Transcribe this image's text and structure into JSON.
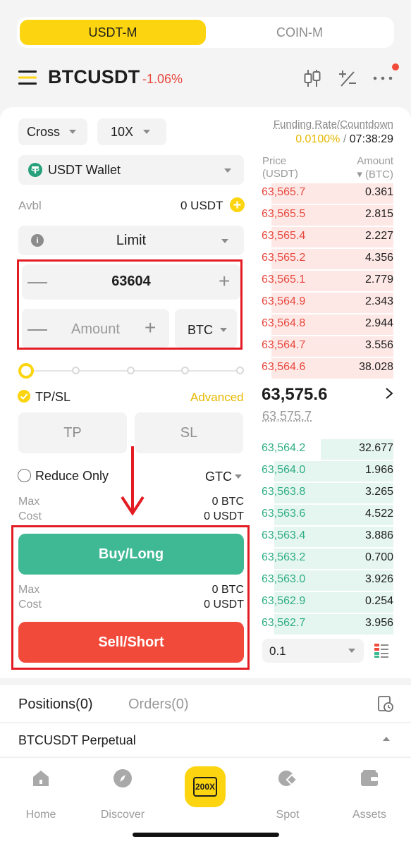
{
  "tabs": {
    "active": "USDT-M",
    "inactive": "COIN-M"
  },
  "header": {
    "symbol": "BTCUSDT",
    "change": "-1.06%"
  },
  "form": {
    "margin_mode": "Cross",
    "leverage": "10X",
    "wallet": "USDT Wallet",
    "avbl_label": "Avbl",
    "avbl_value": "0 USDT",
    "order_type": "Limit",
    "price_value": "63604",
    "amount_placeholder": "Amount",
    "amount_unit": "BTC",
    "slider_percent": 0,
    "tpsl_label": "TP/SL",
    "advanced_label": "Advanced",
    "tp_label": "TP",
    "sl_label": "SL",
    "reduce_only_label": "Reduce Only",
    "tif": "GTC",
    "max_label": "Max",
    "cost_label": "Cost",
    "buy_max": "0 BTC",
    "buy_cost": "0 USDT",
    "buy_label": "Buy/Long",
    "sell_max": "0 BTC",
    "sell_cost": "0 USDT",
    "sell_label": "Sell/Short"
  },
  "orderbook": {
    "funding_label": "Funding Rate/Countdown",
    "funding_rate": "0.0100%",
    "funding_sep": "/",
    "countdown": "07:38:29",
    "price_header": "Price",
    "price_unit": "(USDT)",
    "amount_header": "Amount",
    "amount_unit": "▾ (BTC)",
    "asks": [
      {
        "price": "63,565.7",
        "amount": "0.361",
        "depth": 0.92
      },
      {
        "price": "63,565.5",
        "amount": "2.815",
        "depth": 0.92
      },
      {
        "price": "63,565.4",
        "amount": "2.227",
        "depth": 0.92
      },
      {
        "price": "63,565.2",
        "amount": "4.356",
        "depth": 0.92
      },
      {
        "price": "63,565.1",
        "amount": "2.779",
        "depth": 0.92
      },
      {
        "price": "63,564.9",
        "amount": "2.343",
        "depth": 0.92
      },
      {
        "price": "63,564.8",
        "amount": "2.944",
        "depth": 0.92
      },
      {
        "price": "63,564.7",
        "amount": "3.556",
        "depth": 0.92
      },
      {
        "price": "63,564.6",
        "amount": "38.028",
        "depth": 0.92
      }
    ],
    "last_price": "63,575.6",
    "mark_price": "63,575.7",
    "bids": [
      {
        "price": "63,564.2",
        "amount": "32.677",
        "depth": 0.55
      },
      {
        "price": "63,564.0",
        "amount": "1.966",
        "depth": 0.9
      },
      {
        "price": "63,563.8",
        "amount": "3.265",
        "depth": 0.9
      },
      {
        "price": "63,563.6",
        "amount": "4.522",
        "depth": 0.9
      },
      {
        "price": "63,563.4",
        "amount": "3.886",
        "depth": 0.9
      },
      {
        "price": "63,563.2",
        "amount": "0.700",
        "depth": 0.9
      },
      {
        "price": "63,563.0",
        "amount": "3.926",
        "depth": 0.9
      },
      {
        "price": "63,562.9",
        "amount": "0.254",
        "depth": 0.9
      },
      {
        "price": "63,562.7",
        "amount": "3.956",
        "depth": 0.9
      }
    ],
    "precision": "0.1"
  },
  "bottom": {
    "positions_tab": "Positions(0)",
    "orders_tab": "Orders(0)",
    "perp_label": "BTCUSDT Perpetual"
  },
  "nav": {
    "home": "Home",
    "discover": "Discover",
    "center_badge": "200X",
    "spot": "Spot",
    "assets": "Assets"
  },
  "colors": {
    "accent": "#fcd510",
    "buy": "#3fb993",
    "sell": "#f24a3a",
    "highlight": "#e31b23"
  },
  "icons": [
    "menu-icon",
    "candlestick-icon",
    "calculator-icon",
    "more-icon",
    "tether-icon",
    "info-icon",
    "check-icon",
    "arrow-right-icon",
    "orderbook-layout-icon",
    "history-icon",
    "home-icon",
    "compass-icon",
    "spot-icon",
    "wallet-icon"
  ]
}
